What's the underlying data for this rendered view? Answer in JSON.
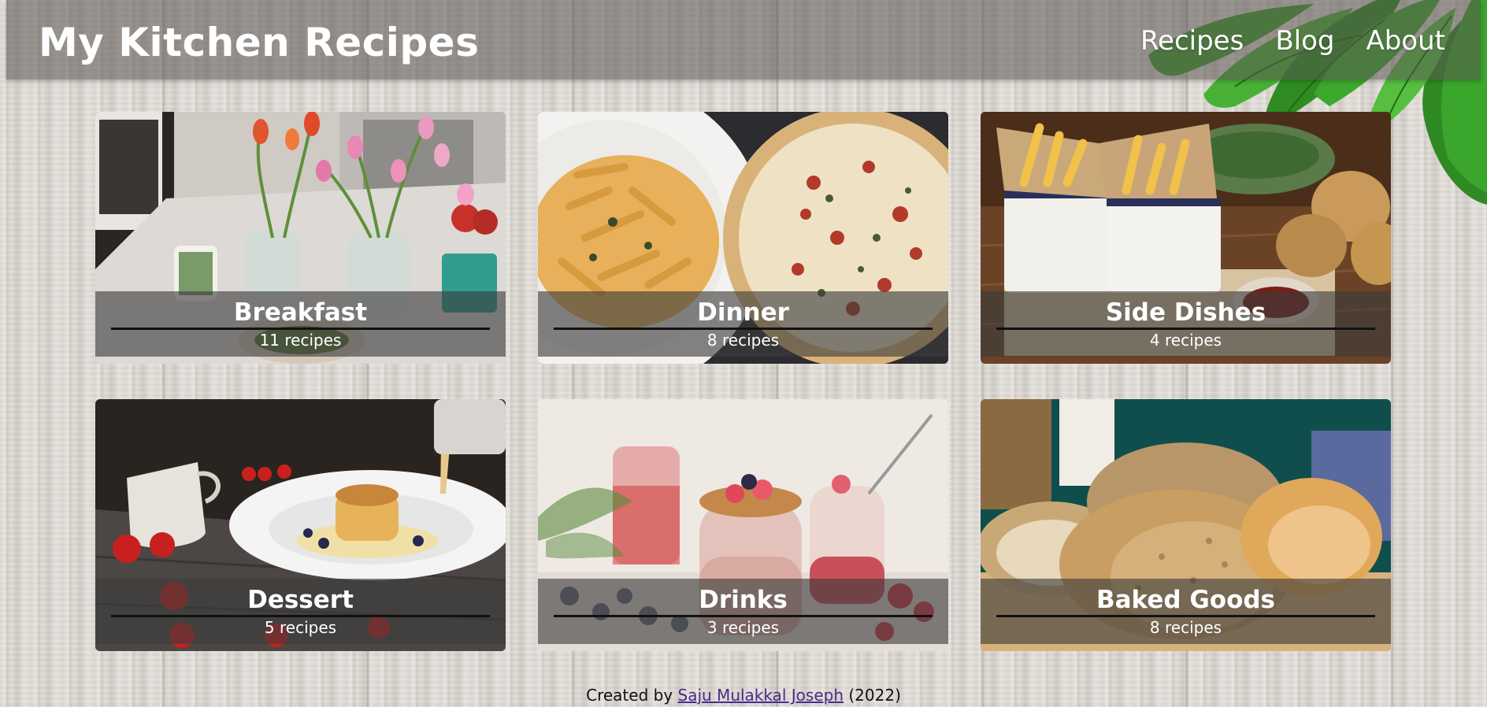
{
  "header": {
    "title": "My Kitchen Recipes",
    "nav": [
      "Recipes",
      "Blog",
      "About"
    ]
  },
  "categories": [
    {
      "name": "Breakfast",
      "count": "11 recipes"
    },
    {
      "name": "Dinner",
      "count": "8 recipes"
    },
    {
      "name": "Side Dishes",
      "count": "4 recipes"
    },
    {
      "name": "Dessert",
      "count": "5 recipes"
    },
    {
      "name": "Drinks",
      "count": "3 recipes"
    },
    {
      "name": "Baked Goods",
      "count": "8 recipes"
    }
  ],
  "footer": {
    "prefix": "Created by ",
    "author": "Saju Mulakkal Joseph",
    "suffix": " (2022)"
  }
}
